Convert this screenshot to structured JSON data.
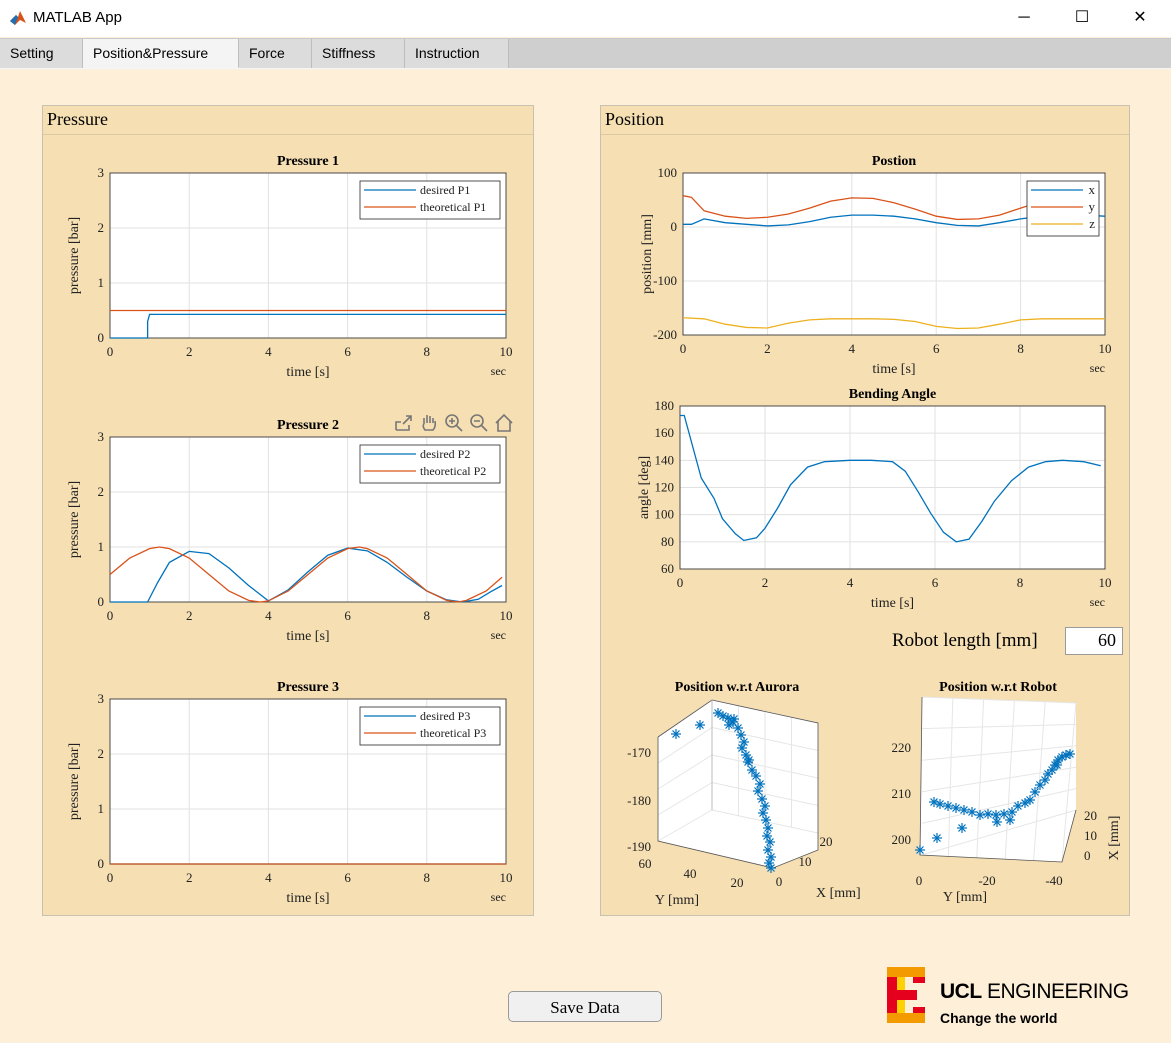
{
  "window": {
    "title": "MATLAB App",
    "minimize": "─",
    "maximize": "☐",
    "close": "✕"
  },
  "tabs": [
    "Setting",
    "Position&Pressure",
    "Force",
    "Stiffness",
    "Instruction"
  ],
  "active_tab": "Position&Pressure",
  "pressure_panel": {
    "title": "Pressure"
  },
  "position_panel": {
    "title": "Position"
  },
  "robot_length": {
    "label": "Robot length [mm]",
    "value": "60"
  },
  "save_button": {
    "label": "Save Data"
  },
  "logo": {
    "line1_bold": "UCL",
    "line1_rest": " ENGINEERING",
    "line2": "Change the world"
  },
  "colors": {
    "blue": "#0072BD",
    "orange": "#D95319",
    "yellow": "#EDB120",
    "scatter": "#0072BD",
    "panel": "#F5DFB3",
    "background": "#FEEFD9"
  },
  "toolbar_icons": [
    "export-icon",
    "pan-icon",
    "zoom-in-icon",
    "zoom-out-icon",
    "home-icon"
  ],
  "chart_data": [
    {
      "id": "pressure1",
      "type": "line",
      "title": "Pressure 1",
      "xlabel": "time [s]",
      "ylabel": "pressure [bar]",
      "xunit": "sec",
      "xlim": [
        0,
        10
      ],
      "ylim": [
        0,
        3
      ],
      "xticks": [
        0,
        2,
        4,
        6,
        8,
        10
      ],
      "yticks": [
        0,
        1,
        2,
        3
      ],
      "legend": "top-right",
      "grid": true,
      "series": [
        {
          "name": "desired P1",
          "color": "#0072BD",
          "x": [
            0,
            0.95,
            0.95,
            1.0,
            10
          ],
          "y": [
            0,
            0,
            0.3,
            0.43,
            0.43
          ]
        },
        {
          "name": "theoretical P1",
          "color": "#D95319",
          "x": [
            0,
            10
          ],
          "y": [
            0.5,
            0.5
          ]
        }
      ]
    },
    {
      "id": "pressure2",
      "type": "line",
      "title": "Pressure 2",
      "xlabel": "time [s]",
      "ylabel": "pressure [bar]",
      "xunit": "sec",
      "xlim": [
        0,
        10
      ],
      "ylim": [
        0,
        3
      ],
      "xticks": [
        0,
        2,
        4,
        6,
        8,
        10
      ],
      "yticks": [
        0,
        1,
        2,
        3
      ],
      "legend": "top-right",
      "grid": true,
      "series": [
        {
          "name": "desired P2",
          "color": "#0072BD",
          "x": [
            0,
            0.95,
            1.2,
            1.5,
            2.0,
            2.5,
            3.0,
            3.5,
            4.0,
            4.5,
            5.0,
            5.5,
            6.0,
            6.5,
            7.0,
            7.5,
            8.0,
            8.5,
            8.9,
            9.3,
            9.6,
            9.9
          ],
          "y": [
            0,
            0,
            0.35,
            0.72,
            0.92,
            0.88,
            0.62,
            0.3,
            0.02,
            0.22,
            0.55,
            0.85,
            0.98,
            0.93,
            0.72,
            0.45,
            0.2,
            0.04,
            0,
            0.05,
            0.18,
            0.3
          ]
        },
        {
          "name": "theoretical P2",
          "color": "#D95319",
          "x": [
            0,
            0.5,
            1.0,
            1.25,
            1.5,
            2.0,
            2.5,
            3.0,
            3.5,
            3.8,
            4.0,
            4.5,
            5.0,
            5.5,
            6.0,
            6.3,
            6.5,
            7.0,
            7.5,
            8.0,
            8.5,
            8.8,
            9.0,
            9.5,
            9.9
          ],
          "y": [
            0.5,
            0.8,
            0.97,
            1.0,
            0.97,
            0.8,
            0.5,
            0.2,
            0.03,
            0,
            0.02,
            0.2,
            0.5,
            0.8,
            0.97,
            1.0,
            0.97,
            0.8,
            0.5,
            0.2,
            0.03,
            0,
            0.03,
            0.2,
            0.45
          ]
        }
      ]
    },
    {
      "id": "pressure3",
      "type": "line",
      "title": "Pressure 3",
      "xlabel": "time [s]",
      "ylabel": "pressure [bar]",
      "xunit": "sec",
      "xlim": [
        0,
        10
      ],
      "ylim": [
        0,
        3
      ],
      "xticks": [
        0,
        2,
        4,
        6,
        8,
        10
      ],
      "yticks": [
        0,
        1,
        2,
        3
      ],
      "legend": "top-right",
      "grid": true,
      "series": [
        {
          "name": "desired P3",
          "color": "#0072BD",
          "x": [
            0,
            10
          ],
          "y": [
            0,
            0
          ]
        },
        {
          "name": "theoretical P3",
          "color": "#D95319",
          "x": [
            0,
            10
          ],
          "y": [
            0,
            0
          ]
        }
      ]
    },
    {
      "id": "position",
      "type": "line",
      "title": "Postion",
      "xlabel": "time [s]",
      "ylabel": "position [mm]",
      "xunit": "sec",
      "xlim": [
        0,
        10
      ],
      "ylim": [
        -200,
        100
      ],
      "xticks": [
        0,
        2,
        4,
        6,
        8,
        10
      ],
      "yticks": [
        -200,
        -100,
        0,
        100
      ],
      "legend": "top-right",
      "grid": true,
      "series": [
        {
          "name": "x",
          "color": "#0072BD",
          "x": [
            0,
            0.2,
            0.5,
            1.0,
            1.5,
            2.0,
            2.5,
            3.0,
            3.5,
            4.0,
            4.5,
            5.0,
            5.5,
            6.0,
            6.5,
            7.0,
            7.5,
            8.0,
            8.5,
            9.0,
            9.5,
            10
          ],
          "y": [
            5,
            5,
            15,
            8,
            5,
            2,
            4,
            10,
            18,
            22,
            22,
            20,
            15,
            8,
            3,
            2,
            8,
            15,
            20,
            22,
            22,
            20
          ]
        },
        {
          "name": "y",
          "color": "#D95319",
          "x": [
            0,
            0.2,
            0.5,
            1.0,
            1.5,
            2.0,
            2.5,
            3.0,
            3.5,
            4.0,
            4.5,
            5.0,
            5.5,
            6.0,
            6.5,
            7.0,
            7.5,
            8.0,
            8.4
          ],
          "y": [
            58,
            55,
            30,
            20,
            16,
            18,
            24,
            35,
            48,
            54,
            53,
            45,
            33,
            20,
            14,
            15,
            22,
            35,
            45
          ]
        },
        {
          "name": "z",
          "color": "#EDB120",
          "x": [
            0,
            0.5,
            1.0,
            1.5,
            2.0,
            2.5,
            3.0,
            3.5,
            4.0,
            4.5,
            5.0,
            5.5,
            6.0,
            6.5,
            7.0,
            7.5,
            8.0,
            8.5,
            9.0,
            9.5,
            10
          ],
          "y": [
            -168,
            -170,
            -180,
            -186,
            -187,
            -178,
            -172,
            -170,
            -170,
            -170,
            -171,
            -175,
            -184,
            -188,
            -187,
            -180,
            -172,
            -170,
            -170,
            -170,
            -170
          ]
        }
      ]
    },
    {
      "id": "bending",
      "type": "line",
      "title": "Bending Angle",
      "xlabel": "time [s]",
      "ylabel": "angle [deg]",
      "xunit": "sec",
      "xlim": [
        0,
        10
      ],
      "ylim": [
        60,
        180
      ],
      "xticks": [
        0,
        2,
        4,
        6,
        8,
        10
      ],
      "yticks": [
        60,
        80,
        100,
        120,
        140,
        160,
        180
      ],
      "grid": true,
      "series": [
        {
          "name": "",
          "color": "#0072BD",
          "x": [
            0,
            0.1,
            0.3,
            0.5,
            0.8,
            1.0,
            1.3,
            1.5,
            1.8,
            2.0,
            2.3,
            2.6,
            3.0,
            3.4,
            4.0,
            4.5,
            5.0,
            5.3,
            5.6,
            5.9,
            6.2,
            6.5,
            6.8,
            7.1,
            7.4,
            7.8,
            8.2,
            8.6,
            9.0,
            9.5,
            9.9
          ],
          "y": [
            173,
            173,
            150,
            127,
            112,
            97,
            86,
            81,
            83,
            90,
            105,
            122,
            135,
            139,
            140,
            140,
            139,
            132,
            117,
            101,
            87,
            80,
            82,
            95,
            110,
            125,
            135,
            139,
            140,
            139,
            136
          ]
        }
      ]
    },
    {
      "id": "aurora3d",
      "type": "scatter",
      "title": "Position w.r.t Aurora",
      "xlabel": "X [mm]",
      "ylabel": "Y [mm]",
      "z_ticks": [
        "-170",
        "-180",
        "-190"
      ],
      "y_ticks": [
        "60",
        "40",
        "20"
      ],
      "x_ticks": [
        "20",
        "10",
        "0"
      ]
    },
    {
      "id": "robot3d",
      "type": "scatter",
      "title": "Position w.r.t Robot",
      "xlabel": "X [mm]",
      "ylabel": "Y [mm]",
      "z_ticks": [
        "220",
        "210",
        "200"
      ],
      "y_ticks": [
        "0",
        "-20",
        "-40"
      ],
      "x_ticks": [
        "20",
        "10",
        "0"
      ]
    }
  ]
}
